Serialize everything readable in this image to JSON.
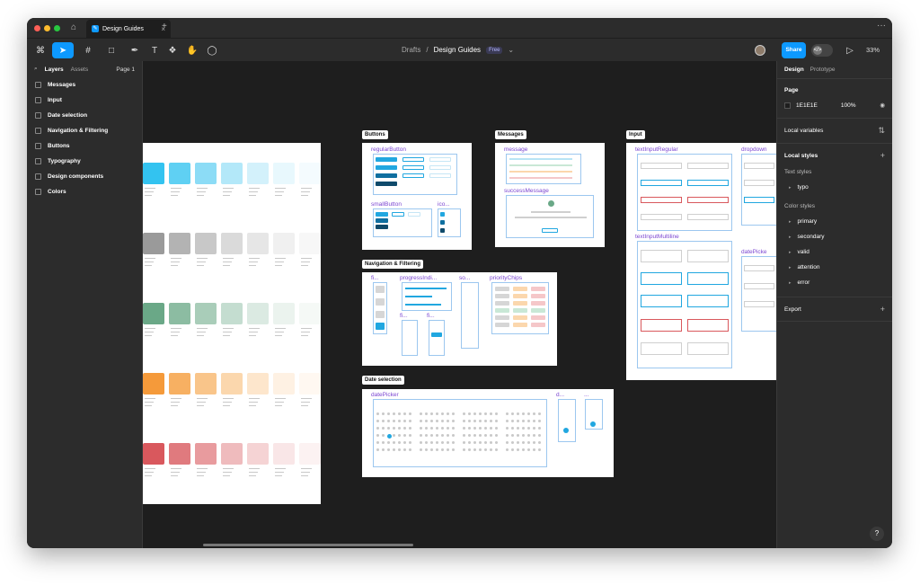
{
  "window": {
    "tab_title": "Design Guides",
    "tab_icon": "figma-file-icon"
  },
  "toolbar": {
    "breadcrumb_parent": "Drafts",
    "breadcrumb_separator": "/",
    "file_name": "Design Guides",
    "plan_badge": "Free",
    "share_label": "Share",
    "zoom_level": "33%"
  },
  "left_panel": {
    "tab_layers": "Layers",
    "tab_assets": "Assets",
    "page_selector": "Page 1",
    "layers": [
      {
        "label": "Messages"
      },
      {
        "label": "Input"
      },
      {
        "label": "Date selection"
      },
      {
        "label": "Navigation & Filtering"
      },
      {
        "label": "Buttons"
      },
      {
        "label": "Typography"
      },
      {
        "label": "Design components"
      },
      {
        "label": "Colors"
      }
    ]
  },
  "canvas": {
    "frames": {
      "buttons": "Buttons",
      "messages": "Messages",
      "input": "Input",
      "navigation": "Navigation & Filtering",
      "date_selection": "Date selection"
    },
    "components": {
      "regular_button": "regularButton",
      "small_button": "smallButton",
      "icon_button": "ico...",
      "message": "message",
      "success_message": "successMessage",
      "text_input_regular": "textInputRegular",
      "dropdown": "dropdown",
      "text_input_multiline": "textInputMultiline",
      "date_picker_input": "datePicke",
      "filter": "fi...",
      "progress_indicator": "progressIndi...",
      "sort": "so...",
      "priority_chips": "priorityChips",
      "filter_2": "fi...",
      "filter_3": "fi...",
      "date_picker": "datePicker",
      "date_small": "d...",
      "date_small_2": "..."
    },
    "palette_rows": [
      {
        "colors": [
          "#33c3f0",
          "#5fd0f3",
          "#8cdcf6",
          "#b3e8f9",
          "#d3f1fb",
          "#e8f8fd",
          "#f4fbfe"
        ]
      },
      {
        "colors": [
          "#9a9a9a",
          "#b3b3b3",
          "#c8c8c8",
          "#dadada",
          "#e6e6e6",
          "#f0f0f0",
          "#f7f7f7"
        ]
      },
      {
        "colors": [
          "#6aa887",
          "#8cbca2",
          "#a9cdb9",
          "#c4ddd0",
          "#dbeae2",
          "#ebf3ee",
          "#f5f9f6"
        ]
      },
      {
        "colors": [
          "#f59a3a",
          "#f7b062",
          "#f9c58a",
          "#fbd7ad",
          "#fde6cc",
          "#fef1e3",
          "#fff8f1"
        ]
      },
      {
        "colors": [
          "#d9585d",
          "#e07a7e",
          "#e89b9e",
          "#efbbbd",
          "#f5d3d4",
          "#f9e6e7",
          "#fcf2f2"
        ]
      }
    ]
  },
  "right_panel": {
    "tab_design": "Design",
    "tab_prototype": "Prototype",
    "page_section": "Page",
    "page_color": "1E1E1E",
    "page_opacity": "100%",
    "local_variables": "Local variables",
    "local_styles": "Local styles",
    "text_styles": "Text styles",
    "text_style_items": [
      "typo"
    ],
    "color_styles": "Color styles",
    "color_style_items": [
      "primary",
      "secondary",
      "valid",
      "attention",
      "error"
    ],
    "export": "Export"
  },
  "help": "?"
}
